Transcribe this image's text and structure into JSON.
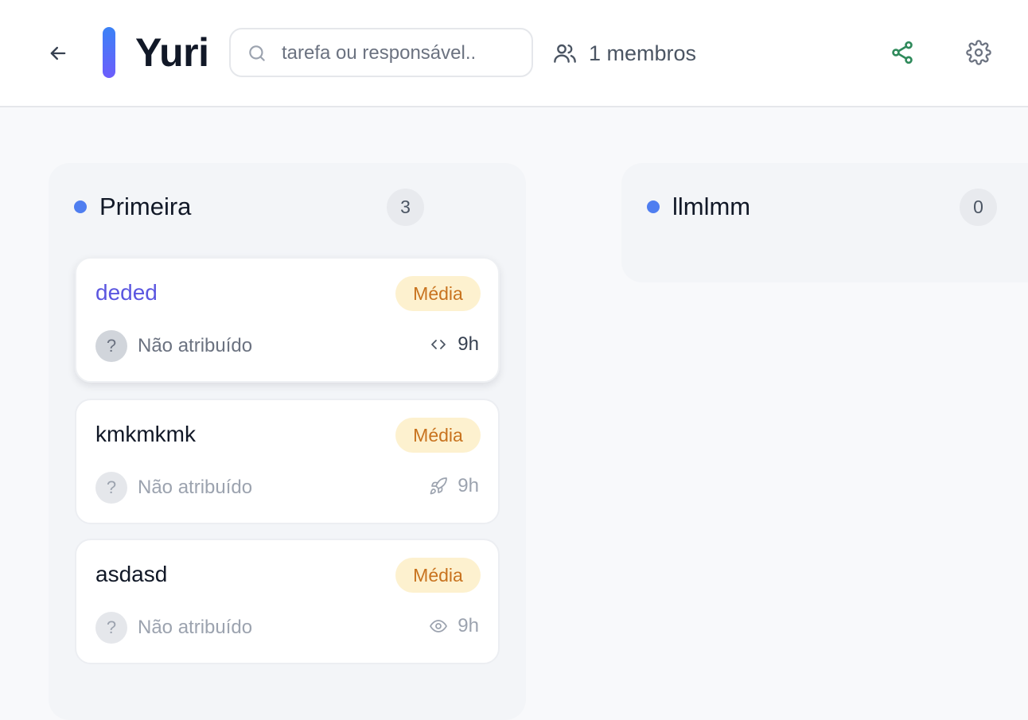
{
  "header": {
    "title": "Yuri",
    "search_placeholder": "tarefa ou responsável..",
    "members_label": "1 membros"
  },
  "colors": {
    "accent_gradient_top": "#3b82f6",
    "accent_gradient_bottom": "#6d5dfc",
    "share_icon": "#2f8a5b",
    "column_dot": "#4f7ef0",
    "badge_bg": "#fdf1cf",
    "badge_text": "#c8731f",
    "active_card_title": "#5b56e0"
  },
  "columns": [
    {
      "title": "Primeira",
      "count": "3",
      "cards": [
        {
          "name": "deded",
          "priority": "Média",
          "assignee": "Não atribuído",
          "avatar": "?",
          "type_icon": "code-icon",
          "hours": "9h"
        },
        {
          "name": "kmkmkmk",
          "priority": "Média",
          "assignee": "Não atribuído",
          "avatar": "?",
          "type_icon": "rocket-icon",
          "hours": "9h"
        },
        {
          "name": "asdasd",
          "priority": "Média",
          "assignee": "Não atribuído",
          "avatar": "?",
          "type_icon": "eye-icon",
          "hours": "9h"
        }
      ]
    },
    {
      "title": "llmlmm",
      "count": "0",
      "cards": []
    }
  ]
}
